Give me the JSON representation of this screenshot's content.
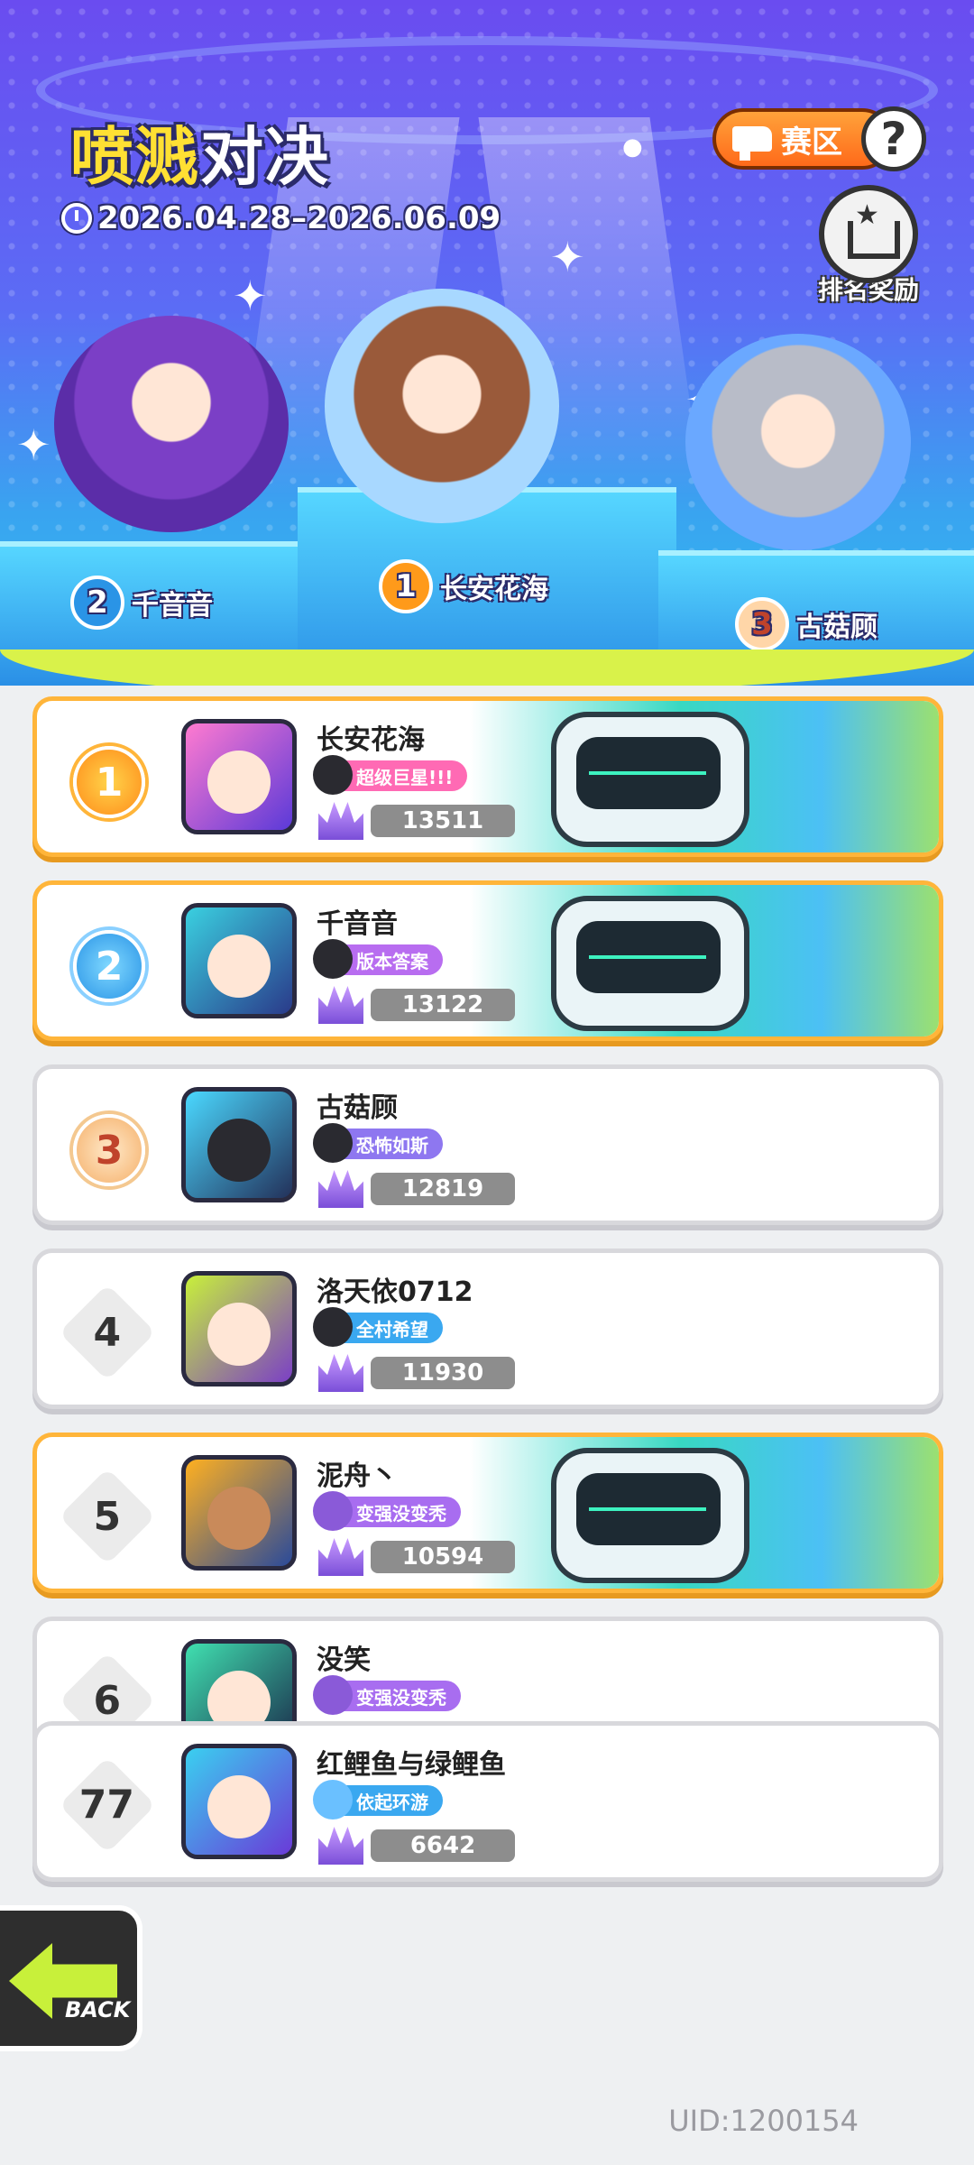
{
  "event": {
    "title_highlight": "喷溅",
    "title_rest": "对决",
    "date_range": "2026.04.28–2026.06.09"
  },
  "top_buttons": {
    "zone_label": "赛区",
    "help_label": "?",
    "reward_label": "排名奖励"
  },
  "podium": [
    {
      "rank": "1",
      "name": "长安花海"
    },
    {
      "rank": "2",
      "name": "千音音"
    },
    {
      "rank": "3",
      "name": "古菇顾"
    }
  ],
  "rankings": [
    {
      "rank": "1",
      "name": "长安花海",
      "title": "超级巨星!!!",
      "score": "13511",
      "title_color": "#ff6ab4"
    },
    {
      "rank": "2",
      "name": "千音音",
      "title": "版本答案",
      "score": "13122",
      "title_color": "#b86df0"
    },
    {
      "rank": "3",
      "name": "古菇顾",
      "title": "恐怖如斯",
      "score": "12819",
      "title_color": "#8e77f0"
    },
    {
      "rank": "4",
      "name": "洛天依0712",
      "title": "全村希望",
      "score": "11930",
      "title_color": "#3aa8f0"
    },
    {
      "rank": "5",
      "name": "泥舟丶",
      "title": "变强没变秃",
      "score": "10594",
      "title_color": "#a86df0"
    },
    {
      "rank": "6",
      "name": "没笑",
      "title": "变强没变秃",
      "score": "",
      "title_color": "#a86df0"
    }
  ],
  "my_rank": {
    "rank": "77",
    "name": "红鲤鱼与绿鲤鱼",
    "title": "依起环游",
    "score": "6642",
    "title_color": "#3aa8f0"
  },
  "back_label": "BACK",
  "uid_text": "UID:1200154",
  "colors": {
    "gold_border": "#ffb53a",
    "slime": "#d9f24a",
    "back_arrow": "#c8f03a"
  }
}
